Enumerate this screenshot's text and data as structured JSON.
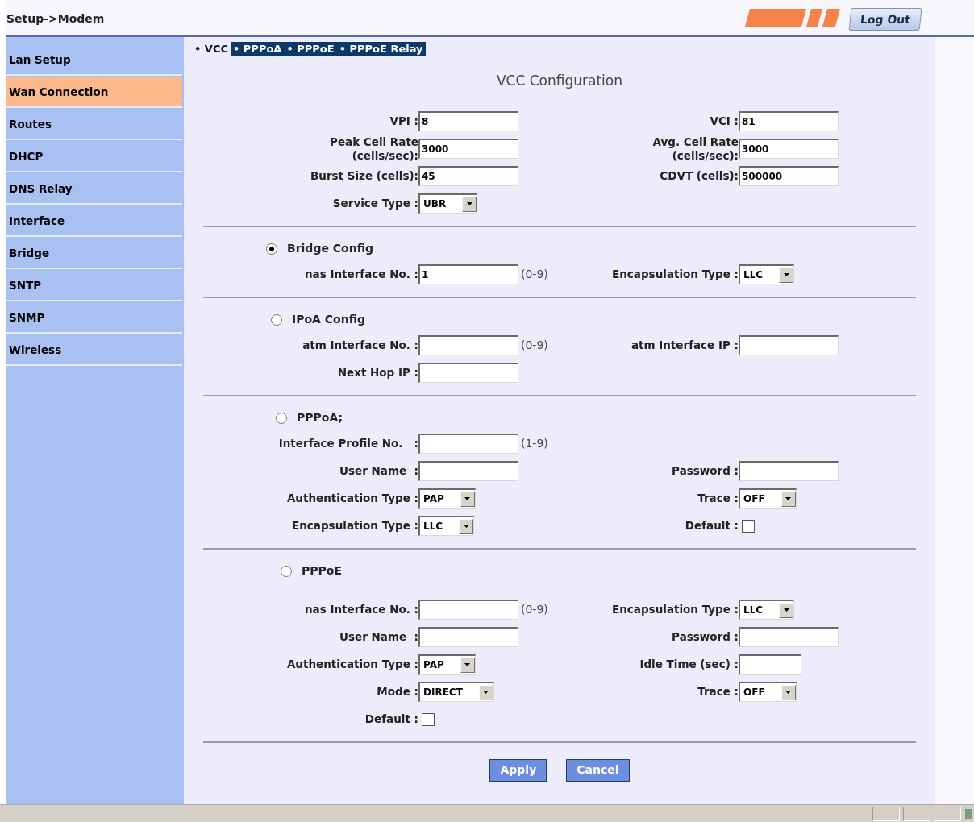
{
  "breadcrumb": "Setup->Modem",
  "logout_button": "Log Out",
  "sidebar": {
    "items": [
      {
        "label": "Lan Setup",
        "selected": false
      },
      {
        "label": "Wan Connection",
        "selected": true
      },
      {
        "label": "Routes",
        "selected": false
      },
      {
        "label": "DHCP",
        "selected": false
      },
      {
        "label": "DNS Relay",
        "selected": false
      },
      {
        "label": "Interface",
        "selected": false
      },
      {
        "label": "Bridge",
        "selected": false
      },
      {
        "label": "SNTP",
        "selected": false
      },
      {
        "label": "SNMP",
        "selected": false
      },
      {
        "label": "Wireless",
        "selected": false
      }
    ]
  },
  "tabs": [
    {
      "label": "• VCC",
      "selected": true
    },
    {
      "label": "• PPPoA",
      "selected": false
    },
    {
      "label": "• PPPoE",
      "selected": false
    },
    {
      "label": "• PPPoE Relay",
      "selected": false
    }
  ],
  "title": "VCC Configuration",
  "sections": [
    {
      "rows": [
        {
          "left": {
            "label": "VPI :",
            "control": {
              "kind": "text",
              "value": "8"
            }
          },
          "right": {
            "label": "VCI :",
            "control": {
              "kind": "text",
              "value": "81"
            }
          }
        },
        {
          "left": {
            "label": "Peak Cell Rate\n(cells/sec):",
            "control": {
              "kind": "text",
              "value": "3000"
            }
          },
          "right": {
            "label": "Avg. Cell Rate\n(cells/sec):",
            "control": {
              "kind": "text",
              "value": "3000"
            }
          }
        },
        {
          "left": {
            "label": "Burst Size (cells):",
            "control": {
              "kind": "text",
              "value": "45"
            }
          },
          "right": {
            "label": "CDVT (cells):",
            "control": {
              "kind": "text",
              "value": "500000"
            }
          }
        },
        {
          "left": {
            "label": "Service Type :",
            "control": {
              "kind": "select",
              "value": "UBR"
            }
          }
        }
      ]
    },
    {
      "radio": {
        "label": "Bridge Config",
        "selected": true
      },
      "rows": [
        {
          "left": {
            "label": "nas Interface No. :",
            "control": {
              "kind": "text",
              "value": "1"
            },
            "hint": "(0-9)"
          },
          "right": {
            "label": "Encapsulation Type :",
            "control": {
              "kind": "select",
              "value": "LLC"
            }
          }
        }
      ]
    },
    {
      "radio": {
        "label": "IPoA Config",
        "selected": false
      },
      "rows": [
        {
          "left": {
            "label": "atm Interface No. :",
            "control": {
              "kind": "text"
            },
            "hint": "(0-9)"
          },
          "right": {
            "label": "atm Interface IP :",
            "control": {
              "kind": "text"
            }
          }
        },
        {
          "left": {
            "label": "Next Hop IP :",
            "control": {
              "kind": "text"
            }
          }
        }
      ]
    },
    {
      "radio": {
        "label": "PPPoA;",
        "selected": false
      },
      "rows": [
        {
          "left": {
            "label": "Interface Profile No.   :",
            "control": {
              "kind": "text"
            },
            "hint": "(1-9)"
          }
        },
        {
          "left": {
            "label": "User Name  :",
            "control": {
              "kind": "text"
            }
          },
          "right": {
            "label": "Password :",
            "control": {
              "kind": "text"
            }
          }
        },
        {
          "left": {
            "label": "Authentication Type :",
            "control": {
              "kind": "select",
              "value": "PAP"
            }
          },
          "right": {
            "label": "Trace :",
            "control": {
              "kind": "select",
              "value": "OFF"
            }
          }
        },
        {
          "left": {
            "label": "Encapsulation Type :",
            "control": {
              "kind": "select",
              "value": "LLC"
            }
          },
          "right": {
            "label": "Default :",
            "control": {
              "kind": "checkbox",
              "checked": false
            }
          }
        }
      ]
    },
    {
      "radio": {
        "label": "PPPoE",
        "selected": false
      },
      "rows": [
        {
          "left": {
            "label": "nas Interface No. :",
            "control": {
              "kind": "text"
            },
            "hint": "(0-9)"
          },
          "right": {
            "label": "Encapsulation Type :",
            "control": {
              "kind": "select",
              "value": "LLC"
            }
          }
        },
        {
          "left": {
            "label": "User Name  :",
            "control": {
              "kind": "text"
            }
          },
          "right": {
            "label": "Password :",
            "control": {
              "kind": "text"
            }
          }
        },
        {
          "left": {
            "label": "Authentication Type :",
            "control": {
              "kind": "select",
              "value": "PAP"
            }
          },
          "right": {
            "label": "Idle Time (sec) :",
            "control": {
              "kind": "short_text"
            }
          }
        },
        {
          "left": {
            "label": "Mode :",
            "control": {
              "kind": "select",
              "value": "DIRECT"
            }
          },
          "right": {
            "label": "Trace :",
            "control": {
              "kind": "select",
              "value": "OFF"
            }
          }
        },
        {
          "left": {
            "label": "Default :",
            "control": {
              "kind": "checkbox",
              "checked": false
            }
          }
        }
      ]
    }
  ],
  "buttons": [
    "Apply",
    "Cancel"
  ]
}
